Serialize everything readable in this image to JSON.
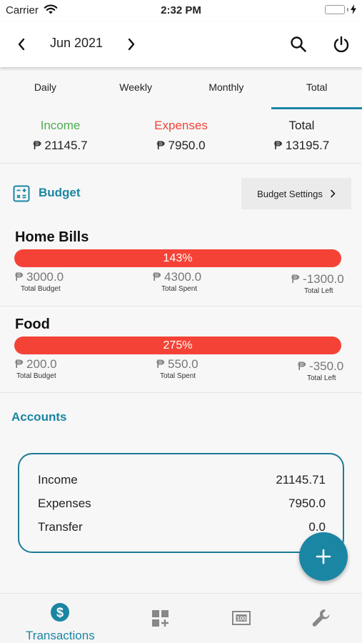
{
  "status_bar": {
    "carrier": "Carrier",
    "time": "2:32 PM"
  },
  "header": {
    "month": "Jun 2021"
  },
  "tabs": [
    {
      "label": "Daily"
    },
    {
      "label": "Weekly"
    },
    {
      "label": "Monthly"
    },
    {
      "label": "Total",
      "active": true
    }
  ],
  "summary": {
    "income": {
      "label": "Income",
      "value": "₱ 21145.7",
      "color": "#4caf50"
    },
    "expenses": {
      "label": "Expenses",
      "value": "₱ 7950.0",
      "color": "#f44336"
    },
    "total": {
      "label": "Total",
      "value": "₱ 13195.7"
    }
  },
  "budget": {
    "title": "Budget",
    "settings_label": "Budget Settings",
    "items": [
      {
        "name": "Home Bills",
        "percent": "143%",
        "total_budget": "₱ 3000.0",
        "total_budget_label": "Total Budget",
        "total_spent": "₱ 4300.0",
        "total_spent_label": "Total Spent",
        "total_left": "₱ -1300.0",
        "total_left_label": "Total Left"
      },
      {
        "name": "Food",
        "percent": "275%",
        "total_budget": "₱ 200.0",
        "total_budget_label": "Total Budget",
        "total_spent": "₱ 550.0",
        "total_spent_label": "Total Spent",
        "total_left": "₱ -350.0",
        "total_left_label": "Total Left"
      }
    ]
  },
  "accounts": {
    "title": "Accounts",
    "rows": [
      {
        "label": "Income",
        "value": "21145.71"
      },
      {
        "label": "Expenses",
        "value": "7950.0"
      },
      {
        "label": "Transfer",
        "value": "0.0"
      }
    ]
  },
  "bottom_nav": {
    "transactions_label": "Transactions"
  },
  "colors": {
    "accent": "#1a86a3",
    "over_budget": "#f44336",
    "income": "#4caf50"
  }
}
